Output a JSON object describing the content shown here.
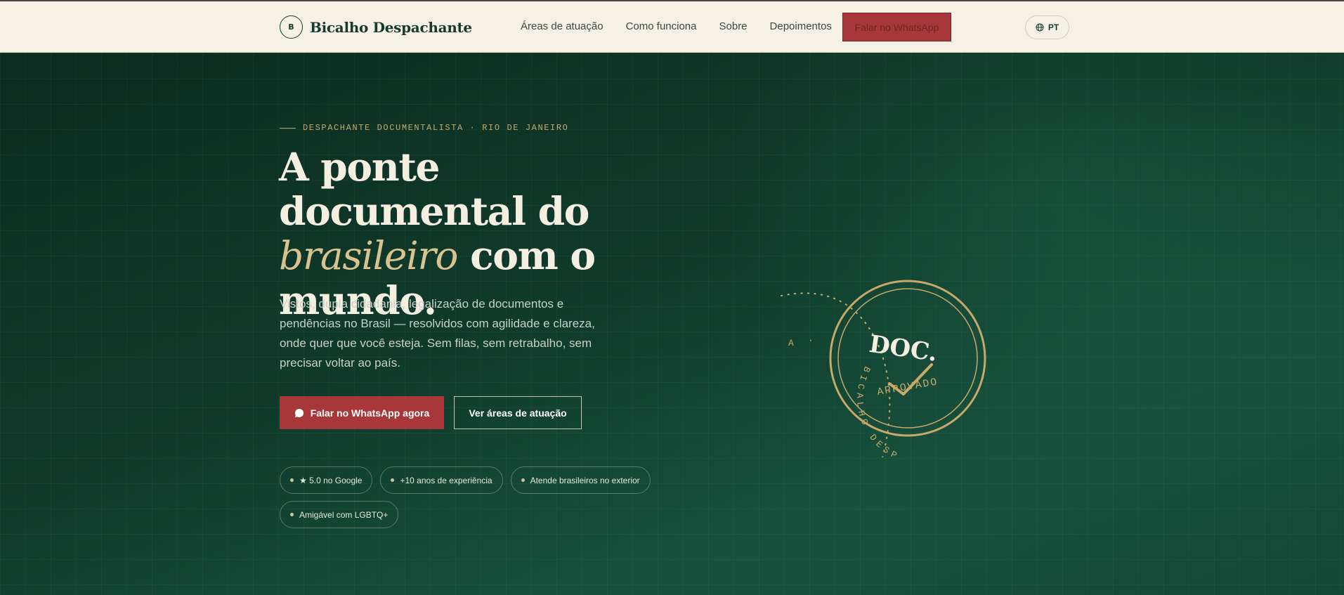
{
  "header": {
    "logo_initial": "B",
    "brand": "Bicalho Despachante",
    "nav": [
      "Áreas de atuação",
      "Como funciona",
      "Sobre",
      "Depoimentos"
    ],
    "cta": "Falar no WhatsApp",
    "lang": "PT"
  },
  "hero": {
    "eyebrow": "DESPACHANTE DOCUMENTALISTA · RIO DE JANEIRO",
    "title_part1": "A ponte documental do",
    "title_em": "brasileiro",
    "title_part2": "com o mundo.",
    "lead": "Vistos, dupla cidadania, legalização de documentos e pendências no Brasil — resolvidos com agilidade e clareza, onde quer que você esteja. Sem filas, sem retrabalho, sem precisar voltar ao país.",
    "primary_cta": "Falar no WhatsApp agora",
    "secondary_cta": "Ver áreas de atuação",
    "badges": [
      "★ 5.0 no Google",
      "+10 anos de experiência",
      "Atende brasileiros no exterior",
      "Amigável com LGBTQ+"
    ]
  },
  "stamp": {
    "title": "DOC.",
    "status": "APROVADO",
    "ring_text": "BICALHO DESPAC.",
    "orbit_letter": "A"
  },
  "colors": {
    "brand_green": "#173a2d",
    "accent_red": "#a8373a",
    "gold": "#c7a96a",
    "cream": "#f5f1e4"
  }
}
